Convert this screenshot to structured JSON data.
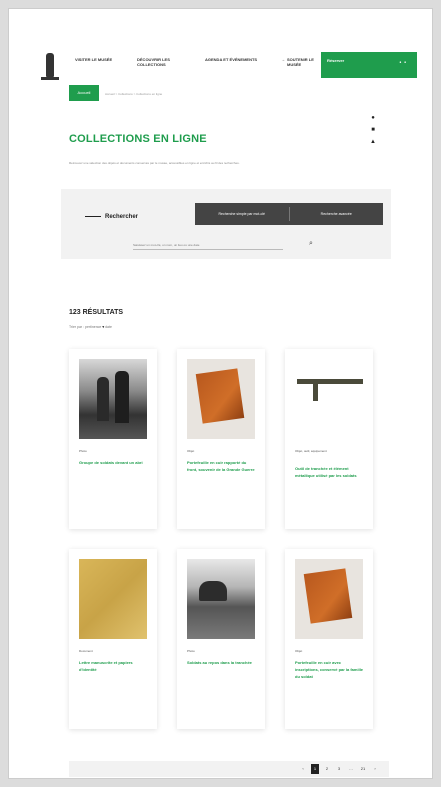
{
  "header": {
    "nav": [
      {
        "label": "Visiter le musée"
      },
      {
        "label": "Découvrir les collections"
      },
      {
        "label": "Agenda et événements"
      },
      {
        "label": "Soutenir le musée"
      }
    ],
    "cta_label": "Réserver",
    "cta_dots": "••"
  },
  "breadcrumb": {
    "home": "Accueil",
    "path": "Accueil > Collections > Collections en ligne"
  },
  "page": {
    "title": "COLLECTIONS EN LIGNE",
    "intro": "Retrouvez une sélection des objets et documents conservés par le musée, accessibles en ligne et enrichis au fil des recherches."
  },
  "side_icons": [
    "●",
    "■",
    "▲"
  ],
  "search": {
    "label": "Rechercher",
    "tabs": [
      {
        "label": "Recherche simple par mot-clé"
      },
      {
        "label": "Recherche avancée"
      }
    ],
    "placeholder": "Saisissez un mot-clé, un nom, un lieu ou une date",
    "go_icon": "⌕"
  },
  "results": {
    "title": "123 RÉSULTATS",
    "sort_label": "Trier par : pertinence",
    "sort_value": "date",
    "sort_caret": "▾"
  },
  "cards": [
    {
      "type": "Photo",
      "title": "Groupe de soldats devant un abri"
    },
    {
      "type": "Objet",
      "title": "Portefeuille en cuir rapporté du front, souvenir de la Grande Guerre"
    },
    {
      "type": "Objet, outil, équipement",
      "title": "Outil de tranchée et élément métallique utilisé par les soldats"
    },
    {
      "type": "Document",
      "title": "Lettre manuscrite et papiers d'identité"
    },
    {
      "type": "Photo",
      "title": "Soldats au repos dans la tranchée"
    },
    {
      "type": "Objet",
      "title": "Portefeuille en cuir avec inscriptions, conservé par la famille du soldat"
    }
  ],
  "pager": {
    "prev": "‹",
    "pages": [
      "1",
      "2",
      "3"
    ],
    "active": "1",
    "ellipsis": "…",
    "last": "21",
    "next": "›"
  }
}
